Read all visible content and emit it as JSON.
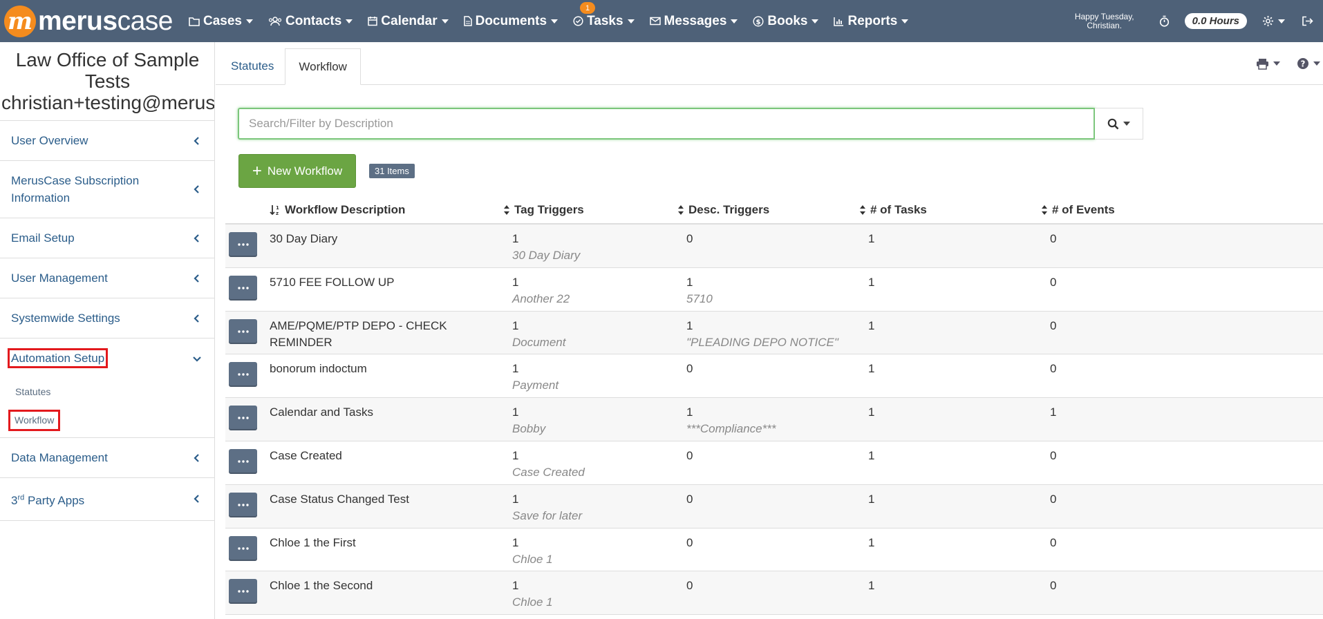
{
  "topbar": {
    "logo_mark": "m",
    "logo_text_bold": "merus",
    "logo_text_light": "case",
    "nav": [
      {
        "label": "Cases"
      },
      {
        "label": "Contacts"
      },
      {
        "label": "Calendar"
      },
      {
        "label": "Documents"
      },
      {
        "label": "Tasks",
        "badge": "1"
      },
      {
        "label": "Messages"
      },
      {
        "label": "Books"
      },
      {
        "label": "Reports"
      }
    ],
    "greeting_line1": "Happy Tuesday,",
    "greeting_line2": "Christian.",
    "hours": "0.0 Hours"
  },
  "sidebar": {
    "office_name": "Law Office of Sample Tests",
    "office_email": "christian+testing@meruscase.com",
    "menu": [
      {
        "label": "User Overview"
      },
      {
        "label": "MerusCase Subscription Information"
      },
      {
        "label": "Email Setup"
      },
      {
        "label": "User Management"
      },
      {
        "label": "Systemwide Settings"
      },
      {
        "label": "Automation Setup"
      },
      {
        "label": "Data Management"
      },
      {
        "label": "3rd Party Apps",
        "base": "3",
        "sup": "rd",
        "rest": " Party Apps"
      }
    ],
    "automation_sub": [
      {
        "label": "Statutes"
      },
      {
        "label": "Workflow"
      }
    ]
  },
  "main": {
    "tabs": [
      {
        "label": "Statutes"
      },
      {
        "label": "Workflow"
      }
    ],
    "search_placeholder": "Search/Filter by Description",
    "new_button": "New Workflow",
    "new_button_plus": "+",
    "items_count": "31 Items",
    "columns": [
      {
        "label": "Workflow Description"
      },
      {
        "label": "Tag Triggers"
      },
      {
        "label": "Desc. Triggers"
      },
      {
        "label": "# of Tasks"
      },
      {
        "label": "# of Events"
      }
    ],
    "rows": [
      {
        "description": "30 Day Diary",
        "tag": "1",
        "tag_sub": "30 Day Diary",
        "desc": "0",
        "desc_sub": "",
        "tasks": "1",
        "events": "0"
      },
      {
        "description": "5710 FEE FOLLOW UP",
        "tag": "1",
        "tag_sub": "Another 22",
        "desc": "1",
        "desc_sub": "5710",
        "tasks": "1",
        "events": "0"
      },
      {
        "description": "AME/PQME/PTP DEPO - CHECK REMINDER",
        "tag": "1",
        "tag_sub": "Document",
        "desc": "1",
        "desc_sub": "\"PLEADING DEPO NOTICE\"",
        "tasks": "1",
        "events": "0"
      },
      {
        "description": "bonorum indoctum",
        "tag": "1",
        "tag_sub": "Payment",
        "desc": "0",
        "desc_sub": "",
        "tasks": "1",
        "events": "0"
      },
      {
        "description": "Calendar and Tasks",
        "tag": "1",
        "tag_sub": "Bobby",
        "desc": "1",
        "desc_sub": "***Compliance***",
        "tasks": "1",
        "events": "1"
      },
      {
        "description": "Case Created",
        "tag": "1",
        "tag_sub": "Case Created",
        "desc": "0",
        "desc_sub": "",
        "tasks": "1",
        "events": "0"
      },
      {
        "description": "Case Status Changed Test",
        "tag": "1",
        "tag_sub": "Save for later",
        "desc": "0",
        "desc_sub": "",
        "tasks": "1",
        "events": "0"
      },
      {
        "description": "Chloe 1 the First",
        "tag": "1",
        "tag_sub": "Chloe 1",
        "desc": "0",
        "desc_sub": "",
        "tasks": "1",
        "events": "0"
      },
      {
        "description": "Chloe 1 the Second",
        "tag": "1",
        "tag_sub": "Chloe 1",
        "desc": "0",
        "desc_sub": "",
        "tasks": "1",
        "events": "0"
      }
    ]
  },
  "colors": {
    "topbar": "#4e6178",
    "accent_orange": "#f58c1e",
    "link": "#2b5d8a",
    "new_button": "#6ba543",
    "highlight_box": "#e3191d"
  }
}
